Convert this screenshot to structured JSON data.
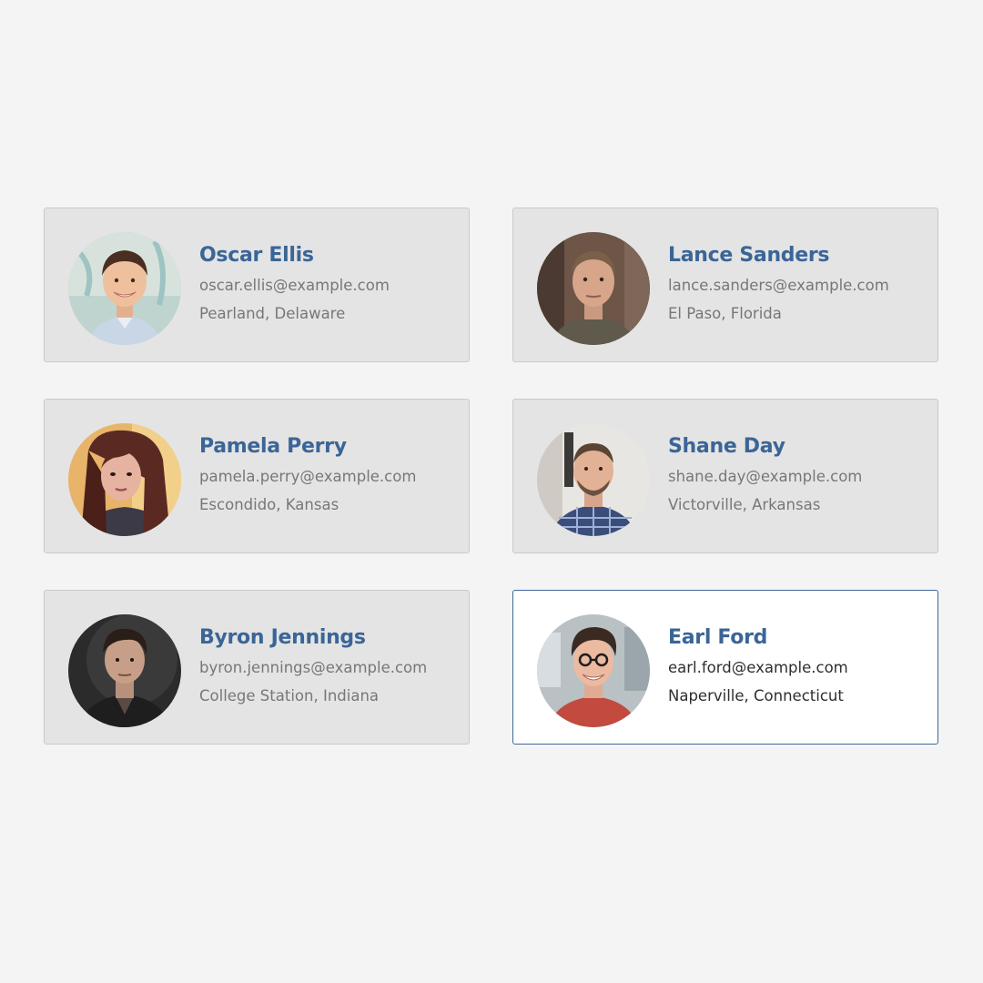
{
  "colors": {
    "page_background": "#f4f4f4",
    "card_background": "#e4e4e4",
    "card_selected_background": "#ffffff",
    "card_selected_border": "#3d679a",
    "name_color": "#3b6597",
    "meta_color": "#777777"
  },
  "contacts": [
    {
      "name": "Oscar Ellis",
      "email": "oscar.ellis@example.com",
      "location": "Pearland, Delaware",
      "avatar_icon": "person-photo",
      "selected": false
    },
    {
      "name": "Lance Sanders",
      "email": "lance.sanders@example.com",
      "location": "El Paso, Florida",
      "avatar_icon": "person-photo",
      "selected": false
    },
    {
      "name": "Pamela Perry",
      "email": "pamela.perry@example.com",
      "location": "Escondido, Kansas",
      "avatar_icon": "person-photo",
      "selected": false
    },
    {
      "name": "Shane Day",
      "email": "shane.day@example.com",
      "location": "Victorville, Arkansas",
      "avatar_icon": "person-photo",
      "selected": false
    },
    {
      "name": "Byron Jennings",
      "email": "byron.jennings@example.com",
      "location": "College Station, Indiana",
      "avatar_icon": "person-photo",
      "selected": false
    },
    {
      "name": "Earl Ford",
      "email": "earl.ford@example.com",
      "location": "Naperville, Connecticut",
      "avatar_icon": "person-photo",
      "selected": true
    }
  ]
}
